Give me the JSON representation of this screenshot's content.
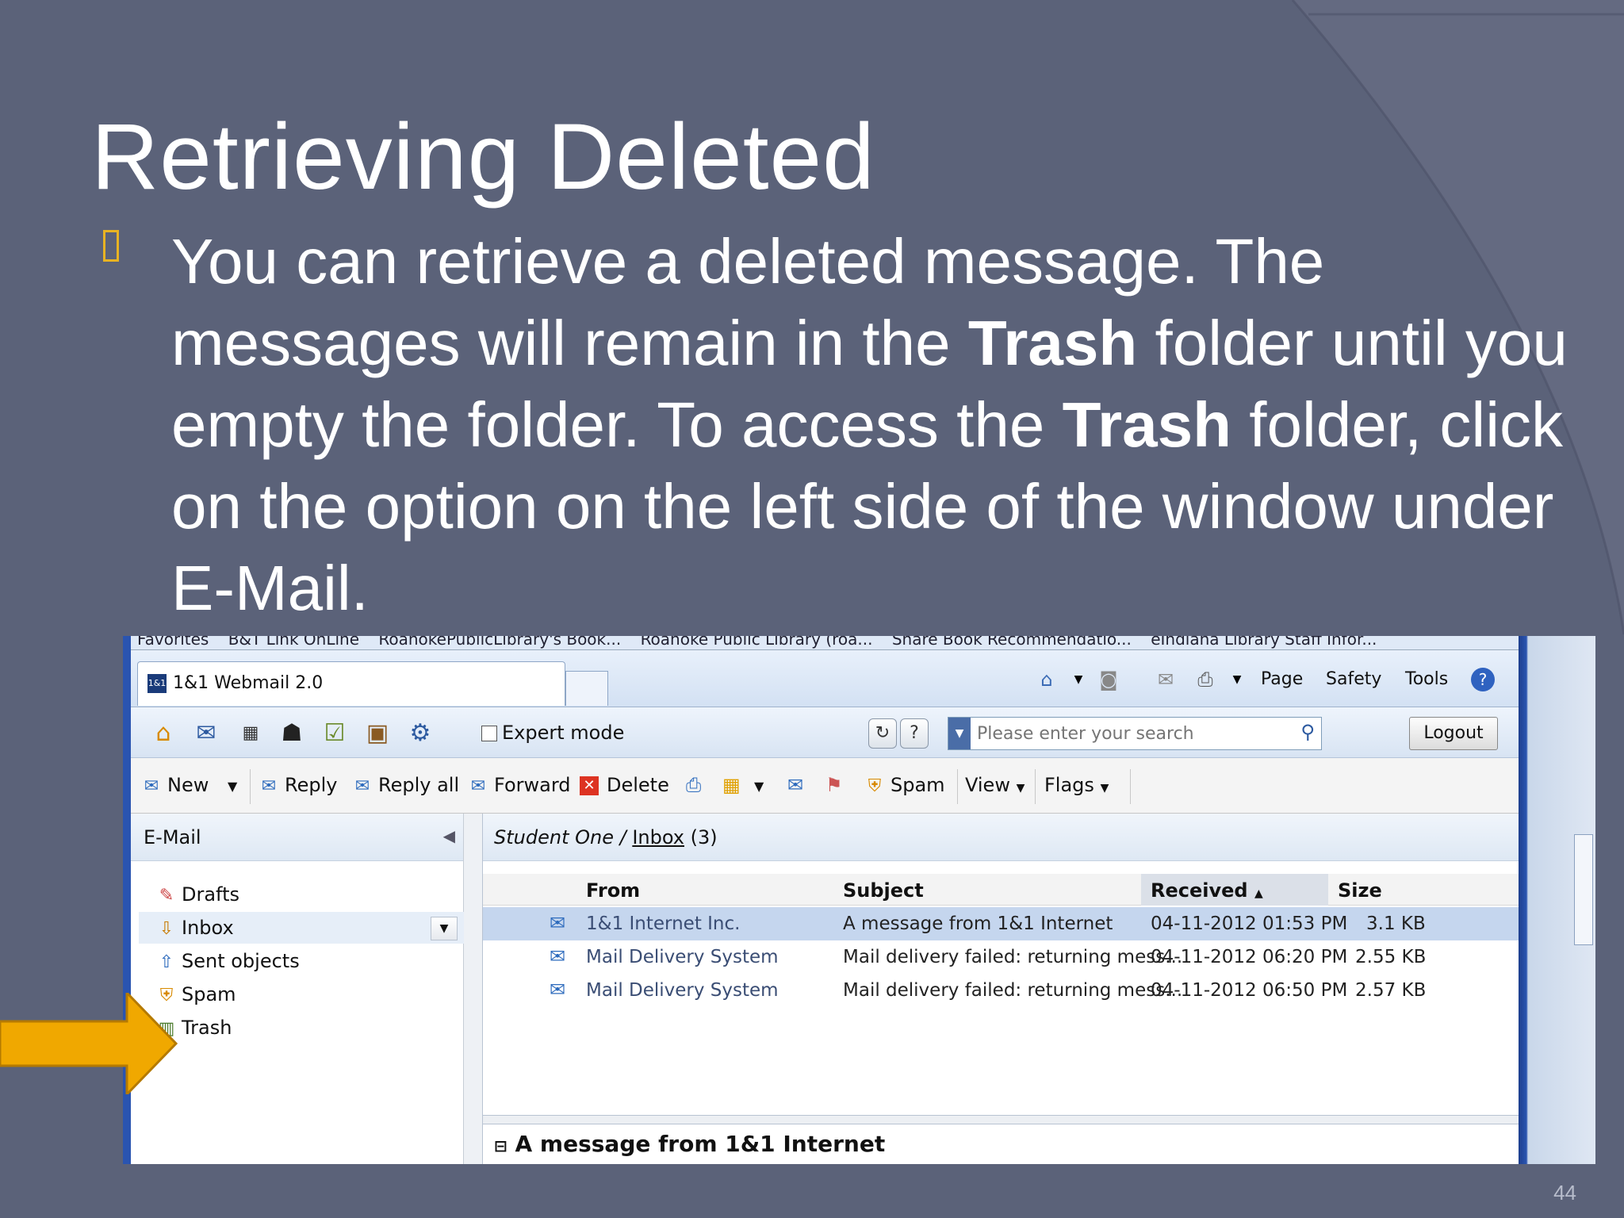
{
  "slide": {
    "title": "Retrieving Deleted",
    "body_1": "You can retrieve a deleted message.  The messages will remain in the ",
    "body_bold_1": "Trash",
    "body_2": " folder until you empty the folder.  To access the ",
    "body_bold_2": "Trash",
    "body_3": " folder, click on the option on the left side of the window under E-Mail.",
    "page_number": "44",
    "colors": {
      "background": "#5b6279",
      "accent": "#e8b323",
      "arrow": "#f0a800"
    }
  },
  "browser": {
    "favorites_bar": [
      "Favorites",
      "B&T Link OnLine",
      "RoanokePublicLibrary's Book...",
      "Roanoke Public Library (roa...",
      "Share Book Recommendatio...",
      "eIndiana Library Staff Infor..."
    ],
    "tab_title": "1&1 Webmail 2.0",
    "tab_icon_text": "1&1",
    "commands": {
      "page": "Page",
      "safety": "Safety",
      "tools": "Tools"
    }
  },
  "toolbar": {
    "expert_mode_label": "Expert mode",
    "search_placeholder": "Please enter your search",
    "logout_label": "Logout"
  },
  "actions": {
    "new": "New",
    "reply": "Reply",
    "reply_all": "Reply all",
    "forward": "Forward",
    "delete": "Delete",
    "spam": "Spam",
    "view": "View",
    "flags": "Flags"
  },
  "sidebar": {
    "header": "E-Mail",
    "folders": [
      {
        "label": "Drafts",
        "icon": "drafts-icon"
      },
      {
        "label": "Inbox",
        "icon": "inbox-icon",
        "selected": true
      },
      {
        "label": "Sent objects",
        "icon": "sent-icon"
      },
      {
        "label": "Spam",
        "icon": "spam-icon"
      },
      {
        "label": "Trash",
        "icon": "trash-icon"
      }
    ]
  },
  "mailbox": {
    "owner": "Student One",
    "folder": "Inbox",
    "count": "(3)",
    "columns": {
      "from": "From",
      "subject": "Subject",
      "received": "Received",
      "size": "Size"
    },
    "messages": [
      {
        "from": "1&1 Internet Inc.",
        "subject": "A message from 1&1 Internet",
        "received": "04-11-2012 01:53 PM",
        "size": "3.1 KB",
        "selected": true
      },
      {
        "from": "Mail Delivery System",
        "subject": "Mail delivery failed: returning mess...",
        "received": "04-11-2012 06:20 PM",
        "size": "2.55 KB"
      },
      {
        "from": "Mail Delivery System",
        "subject": "Mail delivery failed: returning mess...",
        "received": "04-11-2012 06:50 PM",
        "size": "2.57 KB"
      }
    ],
    "preview_title": "A message from 1&1 Internet"
  }
}
